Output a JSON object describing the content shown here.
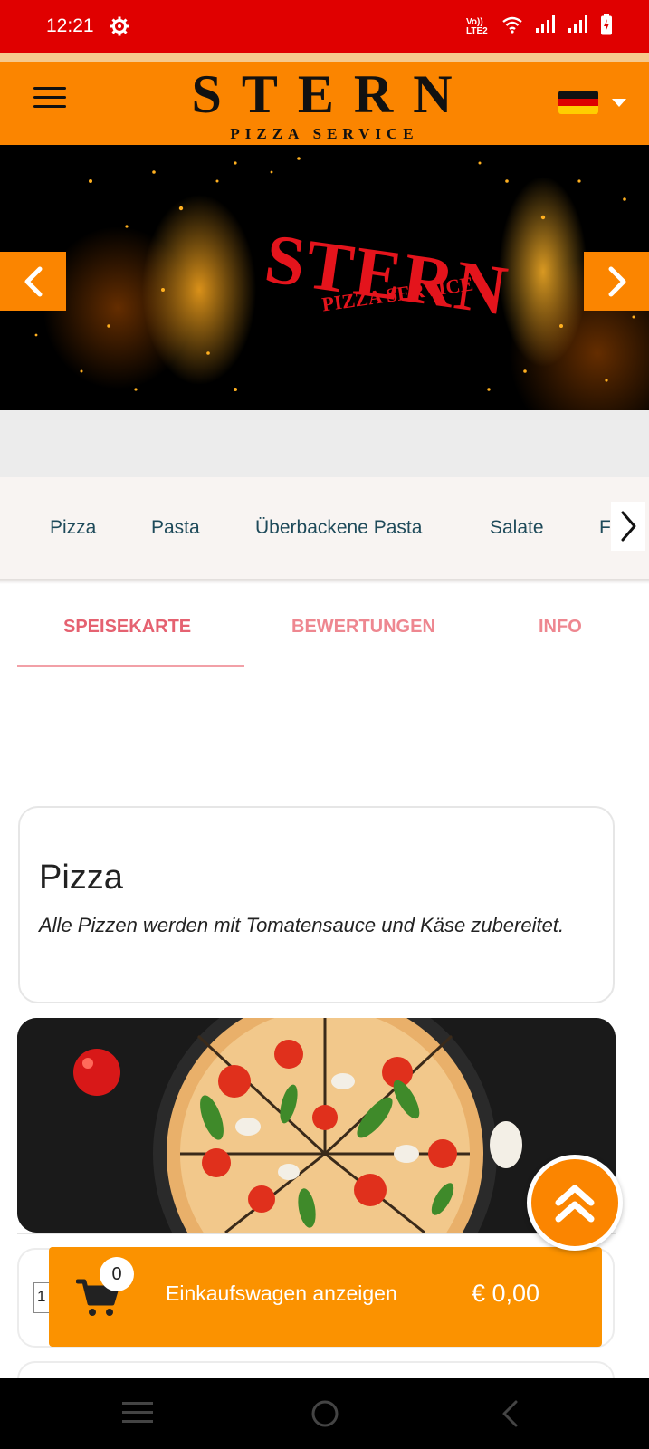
{
  "status_bar": {
    "time": "12:21",
    "lte_label_top": "Vo))",
    "lte_label_bottom": "LTE2"
  },
  "header": {
    "logo_title": "STERN",
    "logo_subtitle": "PIZZA SERVICE",
    "language_flag": "german-flag-icon",
    "brand_color": "#fb8500"
  },
  "hero": {
    "logo_title": "STERN",
    "logo_subtitle": "PIZZA SERVICE",
    "logo_color": "#e4141c"
  },
  "categories": [
    {
      "label": "Pizza"
    },
    {
      "label": "Pasta"
    },
    {
      "label": "Überbackene Pasta"
    },
    {
      "label": "Salate"
    },
    {
      "label": "F"
    }
  ],
  "tabs": [
    {
      "label": "SPEISEKARTE",
      "active": true
    },
    {
      "label": "BEWERTUNGEN",
      "active": false
    },
    {
      "label": "INFO",
      "active": false
    }
  ],
  "menu_section": {
    "title": "Pizza",
    "description": "Alle Pizzen werden mit Tomatensauce und Käse zubereitet."
  },
  "product": {
    "quantity": "1"
  },
  "cart": {
    "count": "0",
    "label": "Einkaufswagen anzeigen",
    "total": "€ 0,00"
  }
}
